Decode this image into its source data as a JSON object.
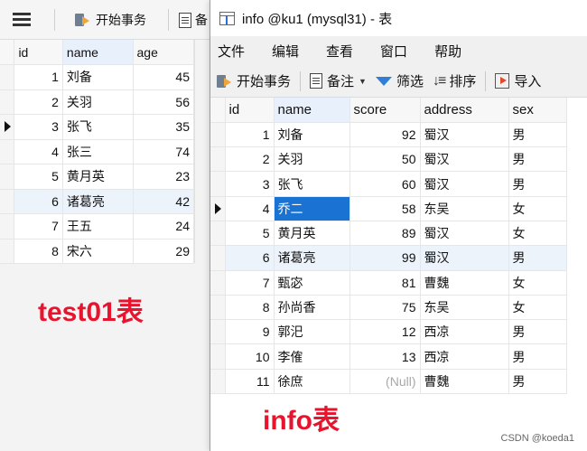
{
  "background_window": {
    "toolbar": {
      "begin_transaction": "开始事务",
      "note_partial": "备"
    },
    "columns": [
      "id",
      "name",
      "age"
    ],
    "rows": [
      {
        "id": "1",
        "name": "刘备",
        "age": "45"
      },
      {
        "id": "2",
        "name": "关羽",
        "age": "56"
      },
      {
        "id": "3",
        "name": "张飞",
        "age": "35"
      },
      {
        "id": "4",
        "name": "张三",
        "age": "74"
      },
      {
        "id": "5",
        "name": "黄月英",
        "age": "23"
      },
      {
        "id": "6",
        "name": "诸葛亮",
        "age": "42"
      },
      {
        "id": "7",
        "name": "王五",
        "age": "24"
      },
      {
        "id": "8",
        "name": "宋六",
        "age": "29"
      }
    ],
    "current_row_index": 2,
    "caption": "test01表"
  },
  "info_window": {
    "title": "info @ku1 (mysql31) - 表",
    "menu": [
      "文件",
      "编辑",
      "查看",
      "窗口",
      "帮助"
    ],
    "toolbar": {
      "begin_transaction": "开始事务",
      "note": "备注",
      "filter": "筛选",
      "sort": "排序",
      "import": "导入"
    },
    "columns": [
      "id",
      "name",
      "score",
      "address",
      "sex"
    ],
    "rows": [
      {
        "id": "1",
        "name": "刘备",
        "score": "92",
        "address": "蜀汉",
        "sex": "男"
      },
      {
        "id": "2",
        "name": "关羽",
        "score": "50",
        "address": "蜀汉",
        "sex": "男"
      },
      {
        "id": "3",
        "name": "张飞",
        "score": "60",
        "address": "蜀汉",
        "sex": "男"
      },
      {
        "id": "4",
        "name": "乔二",
        "score": "58",
        "address": "东吴",
        "sex": "女"
      },
      {
        "id": "5",
        "name": "黄月英",
        "score": "89",
        "address": "蜀汉",
        "sex": "女"
      },
      {
        "id": "6",
        "name": "诸葛亮",
        "score": "99",
        "address": "蜀汉",
        "sex": "男"
      },
      {
        "id": "7",
        "name": "甄宓",
        "score": "81",
        "address": "曹魏",
        "sex": "女"
      },
      {
        "id": "8",
        "name": "孙尚香",
        "score": "75",
        "address": "东吴",
        "sex": "女"
      },
      {
        "id": "9",
        "name": "郭汜",
        "score": "12",
        "address": "西凉",
        "sex": "男"
      },
      {
        "id": "10",
        "name": "李傕",
        "score": "13",
        "address": "西凉",
        "sex": "男"
      },
      {
        "id": "11",
        "name": "徐庶",
        "score": "(Null)",
        "address": "曹魏",
        "sex": "男"
      }
    ],
    "current_row_index": 3,
    "caption": "info表"
  },
  "watermark": "CSDN @koeda1",
  "colors": {
    "caption_red": "#e8132d",
    "selection_blue": "#1a73d3",
    "table_icon_blue": "#2b6fd6"
  }
}
